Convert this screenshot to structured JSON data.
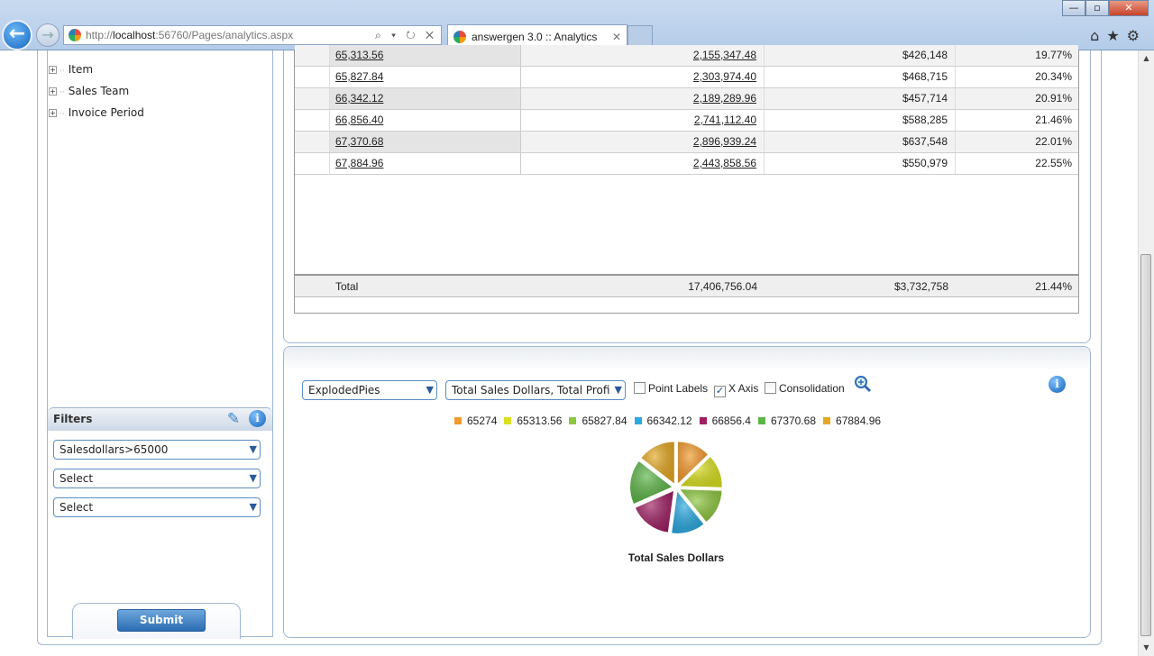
{
  "browser": {
    "url_prefix": "http://",
    "url_host": "localhost",
    "url_rest": ":56760/Pages/analytics.aspx",
    "tab_title": "answergen 3.0 :: Analytics",
    "address_controls": "⌕ ▾ ↻ ✕",
    "window_buttons": [
      "—",
      "▫",
      "✕"
    ],
    "tool_icons": [
      "home-icon",
      "star-icon",
      "gear-icon"
    ]
  },
  "tree": {
    "items": [
      {
        "label": "Item"
      },
      {
        "label": "Sales Team"
      },
      {
        "label": "Invoice Period"
      }
    ]
  },
  "filters": {
    "title": "Filters",
    "selects": [
      "Salesdollars>65000",
      "Select",
      "Select"
    ],
    "submit_label": "Submit"
  },
  "grid": {
    "rows": [
      {
        "key": "65,313.56",
        "sales": "2,155,347.48",
        "profit": "$426,148",
        "pct": "19.77%"
      },
      {
        "key": "65,827.84",
        "sales": "2,303,974.40",
        "profit": "$468,715",
        "pct": "20.34%"
      },
      {
        "key": "66,342.12",
        "sales": "2,189,289.96",
        "profit": "$457,714",
        "pct": "20.91%"
      },
      {
        "key": "66,856.40",
        "sales": "2,741,112.40",
        "profit": "$588,285",
        "pct": "21.46%"
      },
      {
        "key": "67,370.68",
        "sales": "2,896,939.24",
        "profit": "$637,548",
        "pct": "22.01%"
      },
      {
        "key": "67,884.96",
        "sales": "2,443,858.56",
        "profit": "$550,979",
        "pct": "22.55%"
      }
    ],
    "total": {
      "label": "Total",
      "sales": "17,406,756.04",
      "profit": "$3,732,758",
      "pct": "21.44%"
    }
  },
  "chart_controls": {
    "chart_type": "ExplodedPies",
    "measure": "Total Sales Dollars, Total Profi",
    "point_labels": {
      "label": "Point Labels",
      "checked": false
    },
    "x_axis": {
      "label": "X Axis",
      "checked": true
    },
    "consolidation": {
      "label": "Consolidation",
      "checked": false
    }
  },
  "chart_data": {
    "type": "pie",
    "title": "Total Sales Dollars",
    "categories": [
      "65274",
      "65313.56",
      "65827.84",
      "66342.12",
      "66856.4",
      "67370.68",
      "67884.96"
    ],
    "values": [
      2155347.48,
      2155347.48,
      2303974.4,
      2189289.96,
      2741112.4,
      2896939.24,
      2443858.56
    ],
    "colors": [
      "#f39a2b",
      "#d9e021",
      "#8dc63f",
      "#29a9e0",
      "#9e1f63",
      "#5cb547",
      "#e5a823"
    ],
    "legend_position": "top"
  }
}
